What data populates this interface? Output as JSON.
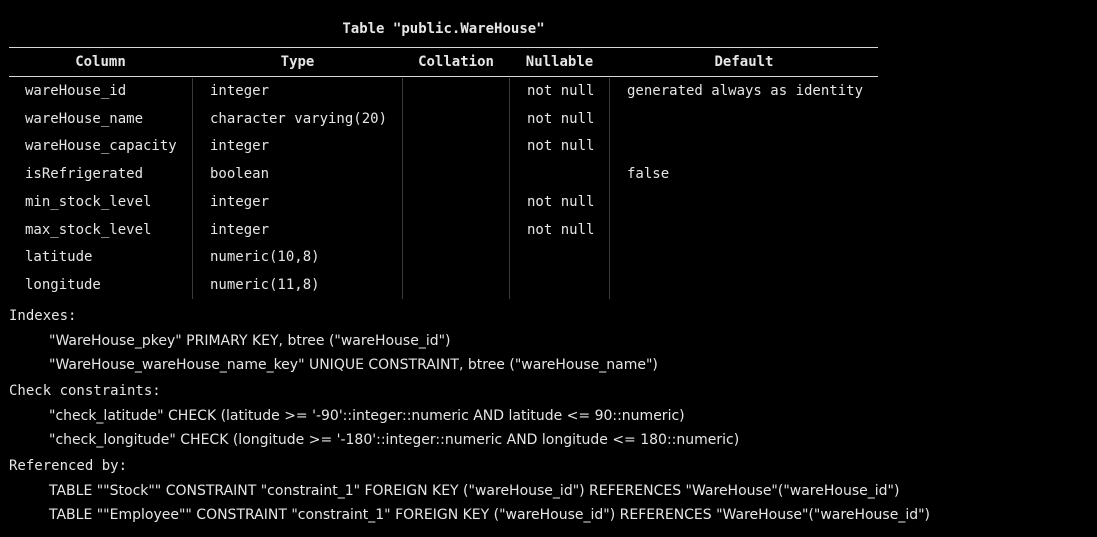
{
  "table_title": "Table \"public.WareHouse\"",
  "columns_header": [
    "Column",
    "Type",
    "Collation",
    "Nullable",
    "Default"
  ],
  "rows": [
    {
      "column": "wareHouse_id",
      "type": "integer",
      "collation": "",
      "nullable": "not null",
      "default": "generated always as identity"
    },
    {
      "column": "wareHouse_name",
      "type": "character varying(20)",
      "collation": "",
      "nullable": "not null",
      "default": ""
    },
    {
      "column": "wareHouse_capacity",
      "type": "integer",
      "collation": "",
      "nullable": "not null",
      "default": ""
    },
    {
      "column": "isRefrigerated",
      "type": "boolean",
      "collation": "",
      "nullable": "",
      "default": "false"
    },
    {
      "column": "min_stock_level",
      "type": "integer",
      "collation": "",
      "nullable": "not null",
      "default": ""
    },
    {
      "column": "max_stock_level",
      "type": "integer",
      "collation": "",
      "nullable": "not null",
      "default": ""
    },
    {
      "column": "latitude",
      "type": "numeric(10,8)",
      "collation": "",
      "nullable": "",
      "default": ""
    },
    {
      "column": "longitude",
      "type": "numeric(11,8)",
      "collation": "",
      "nullable": "",
      "default": ""
    }
  ],
  "indexes": {
    "label": "Indexes:",
    "items": [
      "\"WareHouse_pkey\" PRIMARY KEY, btree (\"wareHouse_id\")",
      "\"WareHouse_wareHouse_name_key\" UNIQUE CONSTRAINT, btree (\"wareHouse_name\")"
    ]
  },
  "check_constraints": {
    "label": "Check constraints:",
    "items": [
      "\"check_latitude\" CHECK (latitude >= '-90'::integer::numeric AND latitude <= 90::numeric)",
      "\"check_longitude\" CHECK (longitude >= '-180'::integer::numeric AND longitude <= 180::numeric)"
    ]
  },
  "referenced_by": {
    "label": "Referenced by:",
    "items": [
      "TABLE \"\"Stock\"\" CONSTRAINT \"constraint_1\" FOREIGN KEY (\"wareHouse_id\") REFERENCES \"WareHouse\"(\"wareHouse_id\")",
      "TABLE \"\"Employee\"\" CONSTRAINT \"constraint_1\" FOREIGN KEY (\"wareHouse_id\") REFERENCES \"WareHouse\"(\"wareHouse_id\")"
    ]
  },
  "colors": {
    "background": "#000000",
    "text": "#e6e6e6",
    "rule": "#d8d8d8",
    "column_separator": "#3a3a3a"
  }
}
